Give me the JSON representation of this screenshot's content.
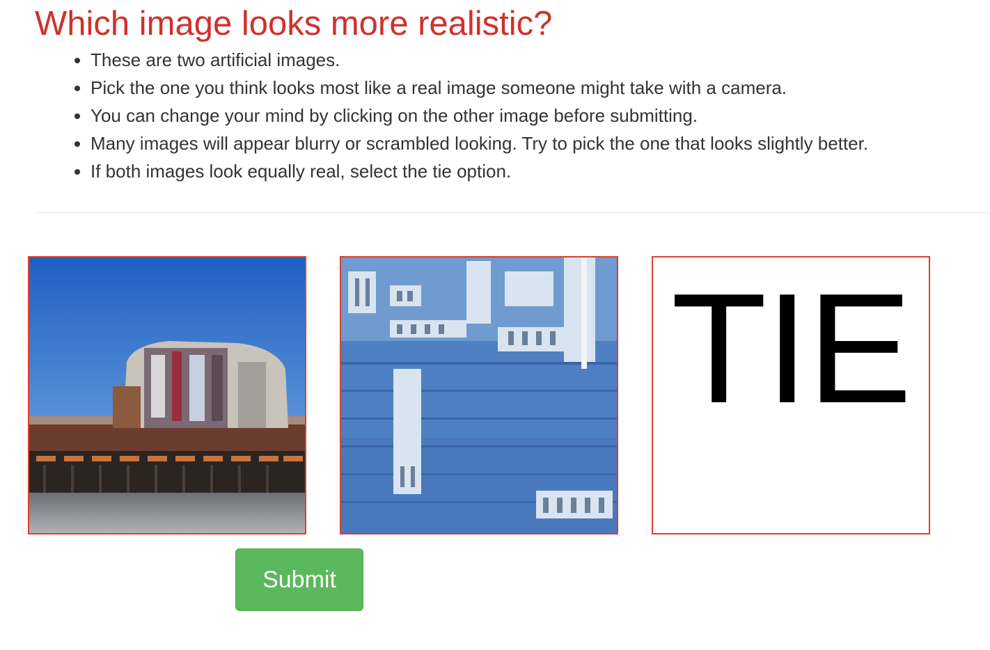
{
  "header": {
    "title": "Which image looks more realistic?"
  },
  "instructions": [
    "These are two artificial images.",
    "Pick the one you think looks most like a real image someone might take with a camera.",
    "You can change your mind by clicking on the other image before submitting.",
    "Many images will appear blurry or scrambled looking. Try to pick the one that looks slightly better.",
    "If both images look equally real, select the tie option."
  ],
  "choices": {
    "tie_label": "TIE"
  },
  "actions": {
    "submit_label": "Submit"
  },
  "colors": {
    "title": "#d0302a",
    "choice_border": "#d9402e",
    "submit_background": "#5cb85c"
  }
}
